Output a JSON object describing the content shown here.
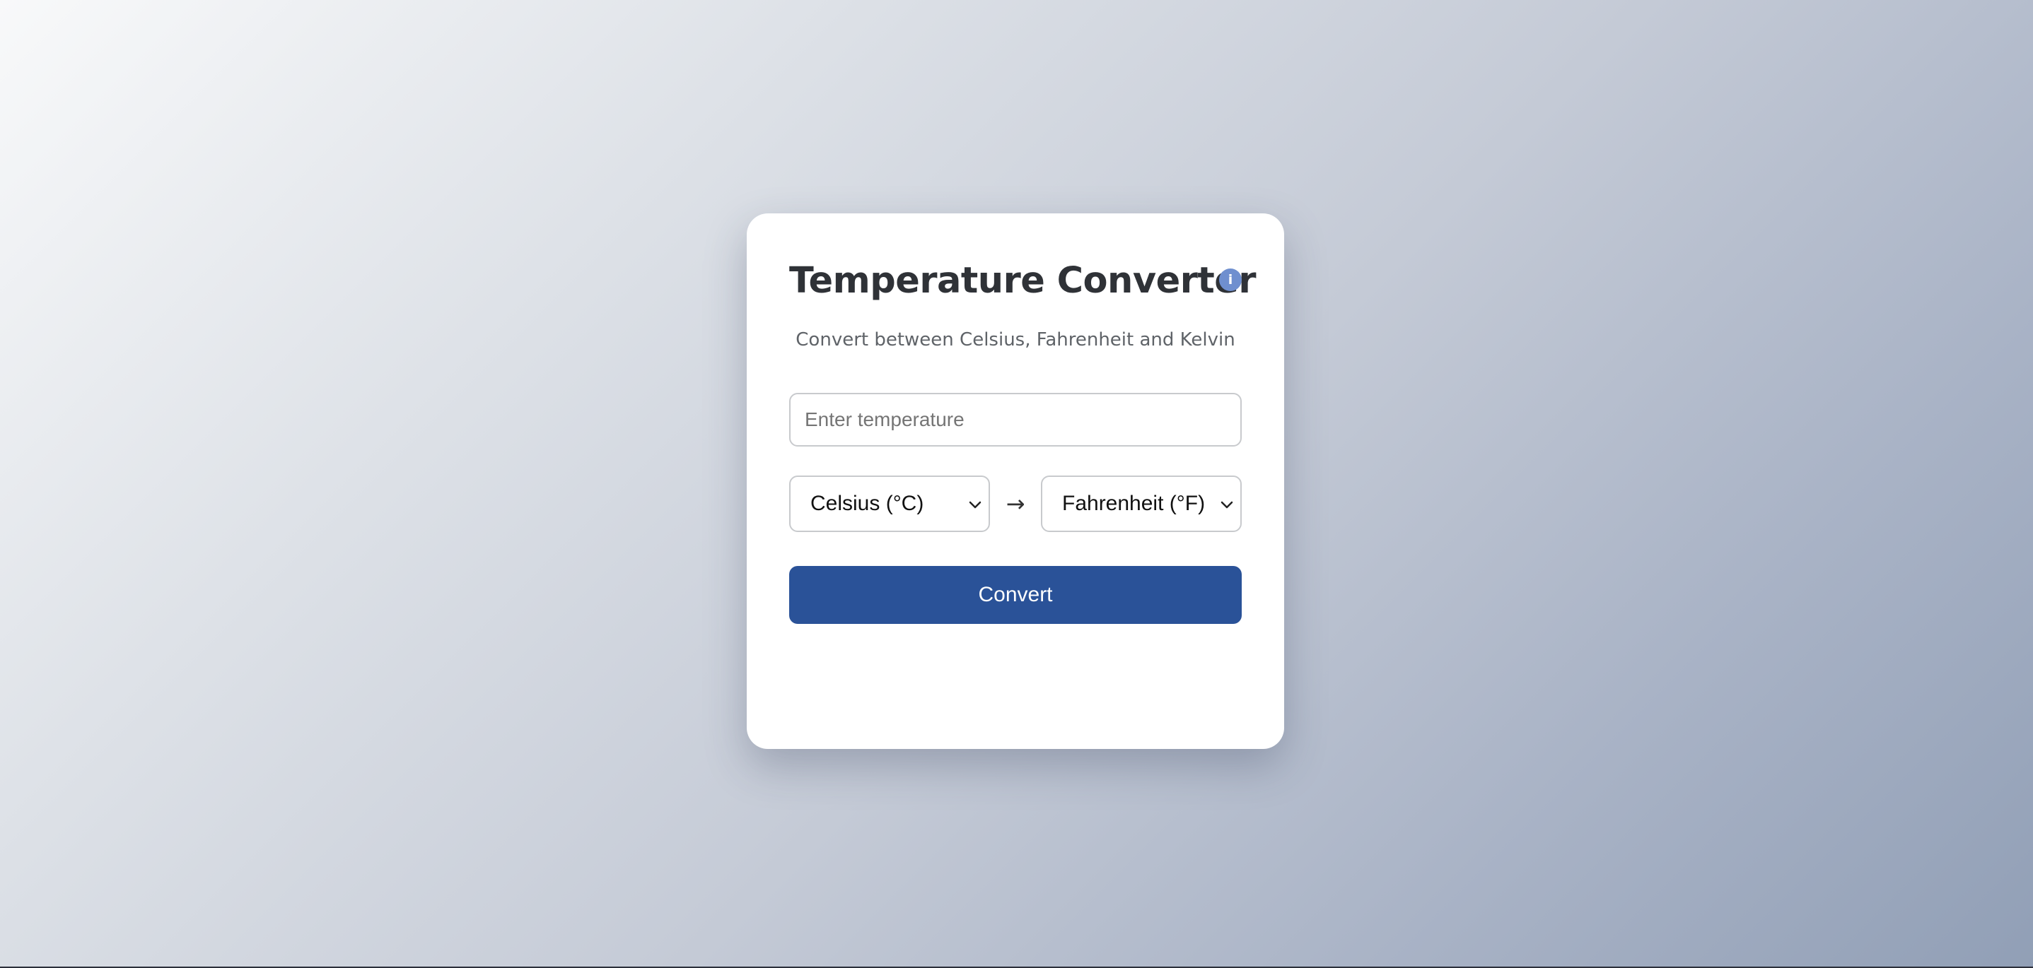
{
  "converter": {
    "title": "Temperature Converter",
    "info_icon_glyph": "i",
    "subtitle": "Convert between Celsius, Fahrenheit and Kelvin",
    "input_placeholder": "Enter temperature",
    "input_value": "",
    "from_unit": "Celsius (°C)",
    "arrow": "→",
    "to_unit": "Fahrenheit (°F)",
    "convert_label": "Convert"
  },
  "icons": {
    "info": "info-icon",
    "chevron": "chevron-down-icon",
    "arrow": "arrow-right-icon"
  },
  "colors": {
    "accent": "#2a5298",
    "info_icon": "#6f8fcf",
    "card_background": "#ffffff"
  }
}
